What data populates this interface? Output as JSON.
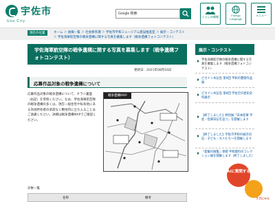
{
  "header": {
    "logo_name": "宇佐市",
    "logo_sub": "Usa City",
    "search_value": "Google 検索",
    "buttons": [
      {
        "label": "くらしの情報"
      },
      {
        "label": "Foreign Language"
      },
      {
        "label": "メニュー"
      }
    ]
  },
  "breadcrumb": {
    "current_label": "現在の位置",
    "line1": "ホーム ＞ 組織一覧 ＞ 社会教育課 ＞ 宇佐市平和ミュージアム建設推進室 ＞ 展示・コンテスト",
    "line2": "＞ 宇佐海軍航空隊の戦争遺構に関する写真を募集します（戦争遺構フォトコンテスト）"
  },
  "main": {
    "title": "宇佐海軍航空隊の戦争遺構に関する写真を募集します（戦争遺構フォトコンテスト）",
    "updated": "更新日：2021年08月16日",
    "section_title": "応募作品対象の戦争遺構について",
    "body": "応募作品対象の戦争遺構について、チラシ裏面（右記）を参照ください。なお、宇佐海軍航空隊の戦争遺構の多くは、現在一般住宅や私有地にある為地所有者の承諾なく敷地内に立ち入ることはご遠慮ください。詳細は戦争遺構MAPでご確認ください。",
    "map_title": "戦争遺構MAP",
    "table_label": "対象一覧",
    "table_headers": [
      "名称",
      "備考"
    ]
  },
  "sidebar": {
    "heading": "展示・コンテスト",
    "items": [
      {
        "label": "宇佐海軍航空隊の戦争遺構に関する写真を募集します（戦争遺構フォトコンテスト）",
        "current": true
      },
      {
        "label": "ピカドン木記念 第9回 平和の賛歌作品展",
        "current": false
      },
      {
        "label": "ピカドン木記念 第8回 宇佐空の歴史史料展示",
        "current": false
      },
      {
        "label": "【終了しました】特別展「日本陸軍 宇佐・陸軍日記を追う」を開催します",
        "current": false
      },
      {
        "label": "【終了しました】宇佐市平和の展示日記・子ども・大人たち～を開催します",
        "current": false
      },
      {
        "label": "「愛媛の展覧」寄贈 平和資料のコレクション展を開催します（終了しました）",
        "current": false
      }
    ]
  },
  "ai_badge": "AIに質問する",
  "mascot_label": "うさにゃん",
  "colors": {
    "brand": "#0b6f5f",
    "link": "#0b5aa0",
    "accent": "#e2462a"
  }
}
